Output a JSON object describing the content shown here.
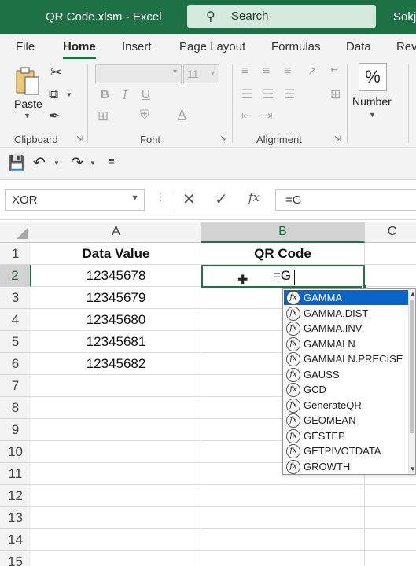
{
  "window": {
    "title": "QR Code.xlsm  -  Excel",
    "search_label": "Search",
    "user": "Sokja"
  },
  "ribbon": {
    "tabs": [
      "File",
      "Home",
      "Insert",
      "Page Layout",
      "Formulas",
      "Data",
      "Rev"
    ],
    "active_tab": "Home",
    "groups": {
      "clipboard": "Clipboard",
      "font": "Font",
      "alignment": "Alignment"
    },
    "paste_label": "Paste",
    "font_size": "11",
    "number_label": "Number",
    "percent_symbol": "%"
  },
  "formula_bar": {
    "name_box": "XOR",
    "formula": "=G",
    "fx_label": "fx"
  },
  "grid": {
    "columns": [
      "A",
      "B",
      "C"
    ],
    "selected_column": "B",
    "rows": [
      "1",
      "2",
      "3",
      "4",
      "5",
      "6",
      "7",
      "8",
      "9",
      "10",
      "11",
      "12",
      "13",
      "14",
      "15"
    ],
    "selected_row": "2",
    "header": {
      "a": "Data Value",
      "b": "QR Code"
    },
    "values": [
      "12345678",
      "12345679",
      "12345680",
      "12345681",
      "12345682"
    ],
    "active_cell_text": "=G"
  },
  "autocomplete": {
    "items": [
      "GAMMA",
      "GAMMA.DIST",
      "GAMMA.INV",
      "GAMMALN",
      "GAMMALN.PRECISE",
      "GAUSS",
      "GCD",
      "GenerateQR",
      "GEOMEAN",
      "GESTEP",
      "GETPIVOTDATA",
      "GROWTH"
    ],
    "highlighted": "GAMMA",
    "icon_label": "fx"
  },
  "colors": {
    "title_bar": "#1e7145",
    "accent": "#217346",
    "highlight": "#0a64c8"
  }
}
